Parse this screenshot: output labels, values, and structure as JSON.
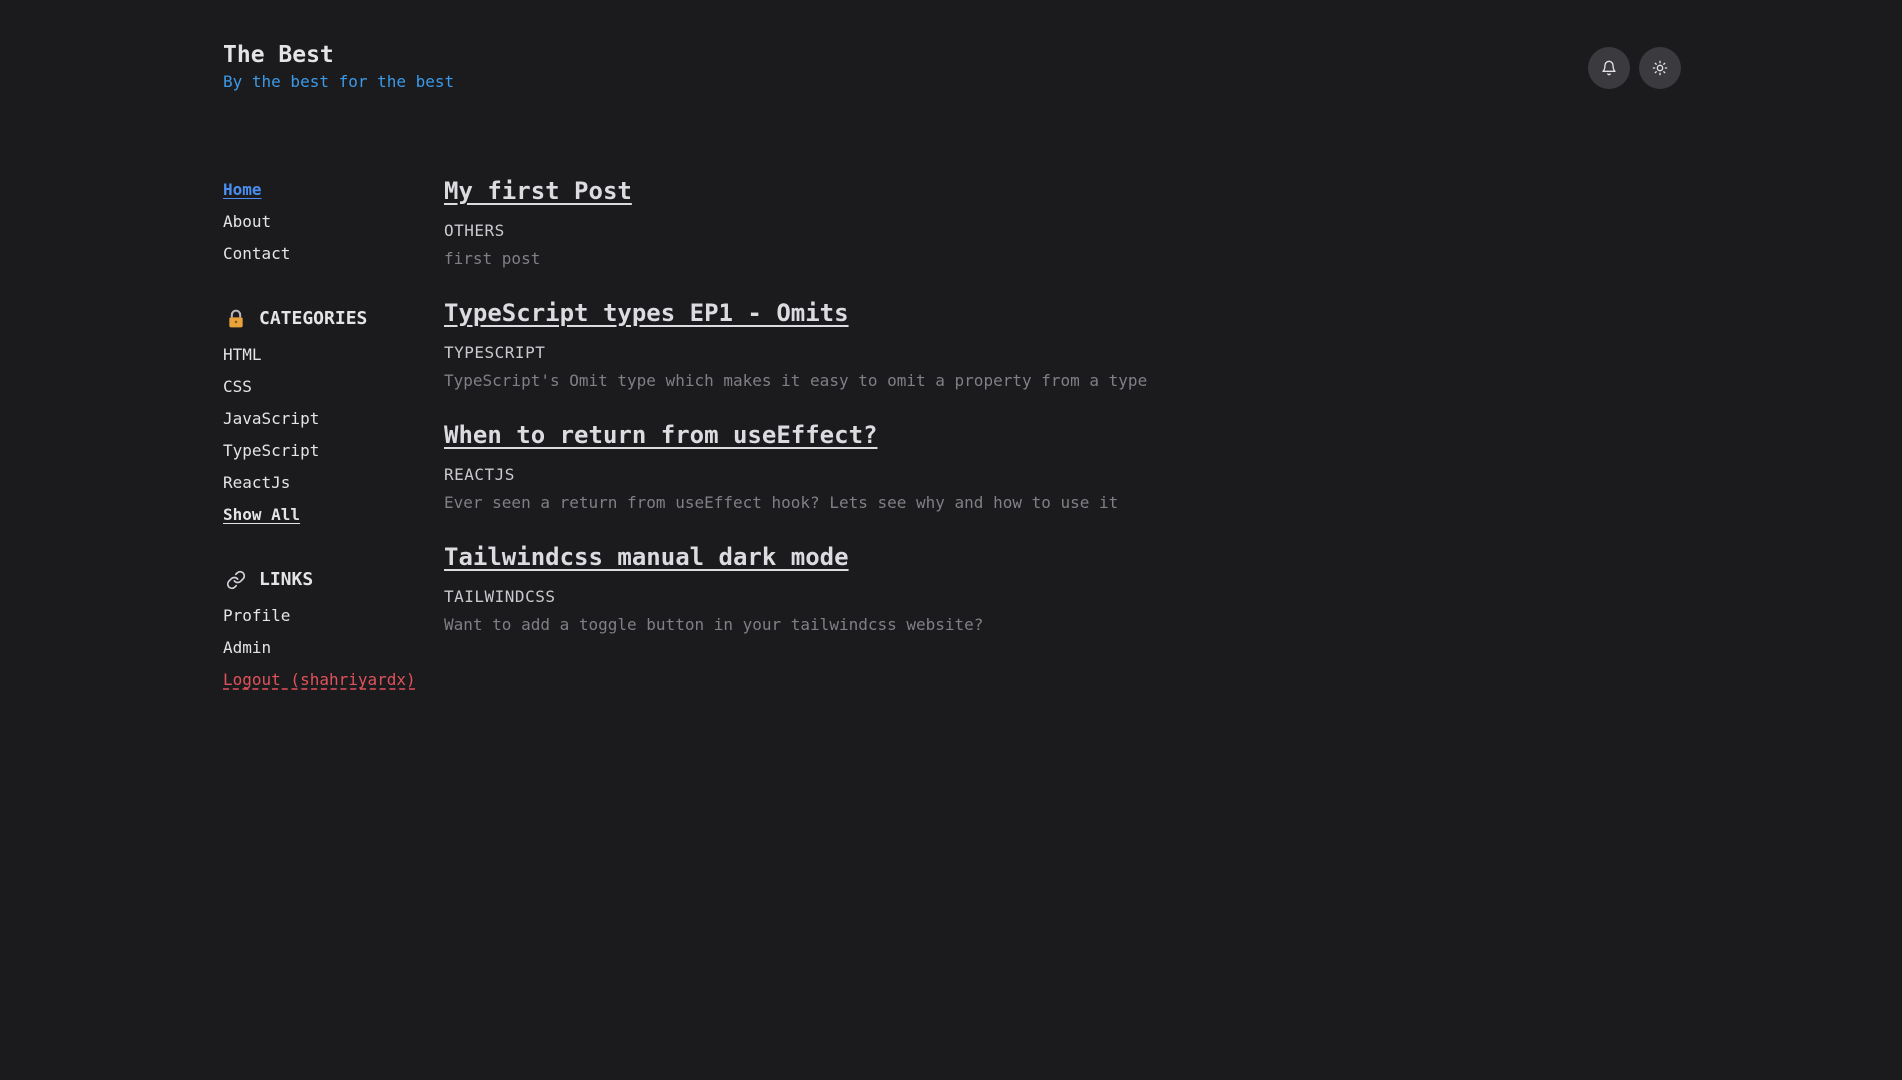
{
  "header": {
    "title": "The Best",
    "tagline": "By the best for the best",
    "notifications_icon": "bell-icon",
    "theme_icon": "sun-icon"
  },
  "sidebar": {
    "nav": [
      {
        "label": "Home",
        "active": true
      },
      {
        "label": "About",
        "active": false
      },
      {
        "label": "Contact",
        "active": false
      }
    ],
    "categories": {
      "heading": "CATEGORIES",
      "icon": "lock-icon",
      "items": [
        "HTML",
        "CSS",
        "JavaScript",
        "TypeScript",
        "ReactJs"
      ],
      "show_all": "Show All"
    },
    "links": {
      "heading": "LINKS",
      "icon": "link-icon",
      "items": [
        "Profile",
        "Admin"
      ],
      "logout": "Logout (shahriyardx)"
    }
  },
  "posts": [
    {
      "title": "My first Post",
      "category": "OTHERS",
      "description": "first post"
    },
    {
      "title": "TypeScript types EP1 - Omits",
      "category": "TYPESCRIPT",
      "description": "TypeScript's Omit type which makes it easy to omit a property from a type"
    },
    {
      "title": "When to return from useEffect?",
      "category": "REACTJS",
      "description": "Ever seen a return from useEffect hook? Lets see why and how to use it"
    },
    {
      "title": "Tailwindcss manual dark mode",
      "category": "TAILWINDCSS",
      "description": "Want to add a toggle button in your tailwindcss website?"
    }
  ],
  "colors": {
    "background": "#1b1b1e",
    "accent_blue": "#4a8ef0",
    "tagline_blue": "#3b9ae8",
    "logout_red": "#e0525b"
  }
}
